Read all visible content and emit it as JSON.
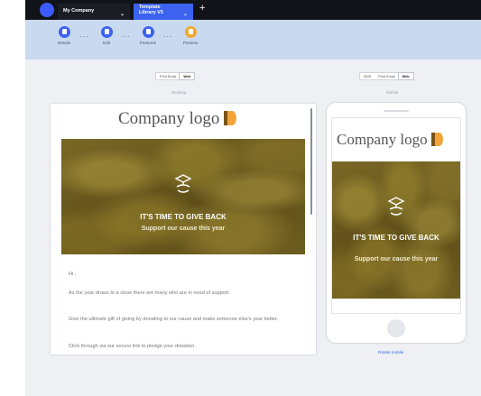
{
  "tabs": [
    {
      "label": "My Company"
    },
    {
      "label": "Template Library V5"
    }
  ],
  "steps": [
    {
      "label": "Details",
      "color": "#3b63f0"
    },
    {
      "label": "Edit",
      "color": "#3b63f0"
    },
    {
      "label": "Features",
      "color": "#3b63f0"
    },
    {
      "label": "Preview",
      "color": "#f0a830"
    }
  ],
  "desktop": {
    "toggle": [
      "Print Email",
      "Web"
    ],
    "caption": "Desktop"
  },
  "mobile": {
    "toggle": [
      "SMS",
      "Print Email",
      "Web"
    ],
    "caption": "Mobile",
    "rotate_label": "Rotate mobile"
  },
  "email": {
    "logo_text": "Company logo",
    "hero_title": "IT'S TIME TO GIVE BACK",
    "hero_subtitle": "Support our cause this year",
    "greeting": "Hi ,",
    "paragraphs": [
      "As the year draws to a close there are many who are in need of support.",
      "Give the ultimate gift of giving by donating to our cause and make someone else's year better.",
      "Click through via our secure link to pledge your donation."
    ]
  },
  "colors": {
    "accent": "#3b63f0",
    "preview_step": "#f0a830",
    "logo_orange": "#f2a33a",
    "logo_dark": "#7a5318"
  }
}
